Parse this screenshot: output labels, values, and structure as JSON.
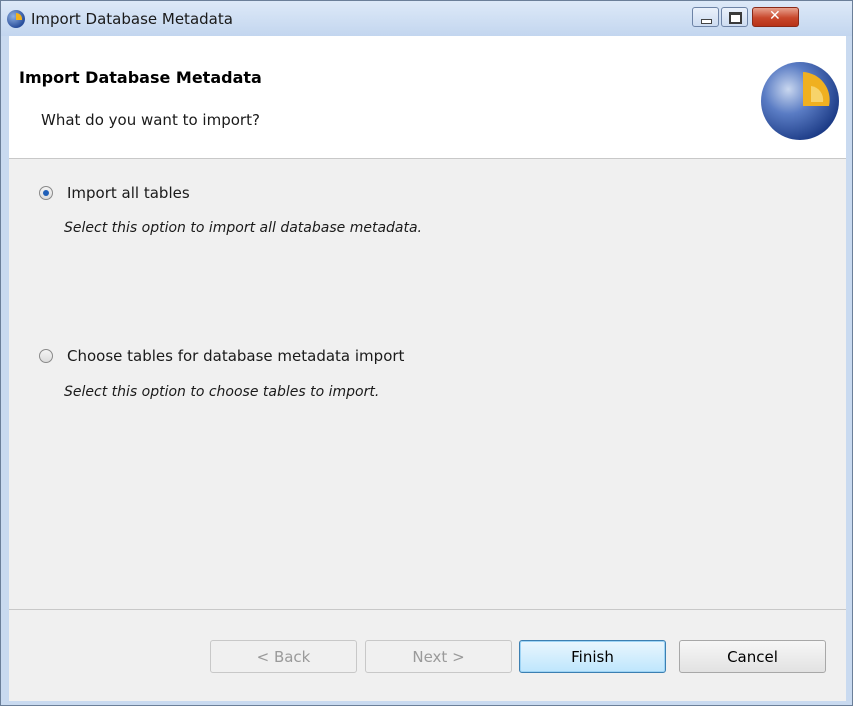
{
  "window": {
    "title": "Import Database Metadata"
  },
  "header": {
    "title": "Import Database Metadata",
    "subtitle": "What do you want to import?"
  },
  "options": [
    {
      "label": "Import all tables",
      "description": "Select this option to import all database metadata.",
      "selected": true
    },
    {
      "label": "Choose tables for database metadata import",
      "description": "Select this option to choose tables to import.",
      "selected": false
    }
  ],
  "buttons": {
    "back": "< Back",
    "next": "Next >",
    "finish": "Finish",
    "cancel": "Cancel"
  },
  "colors": {
    "accent": "#1f5fb8",
    "titlebar": "#c3d6ef",
    "close": "#c8472b"
  }
}
